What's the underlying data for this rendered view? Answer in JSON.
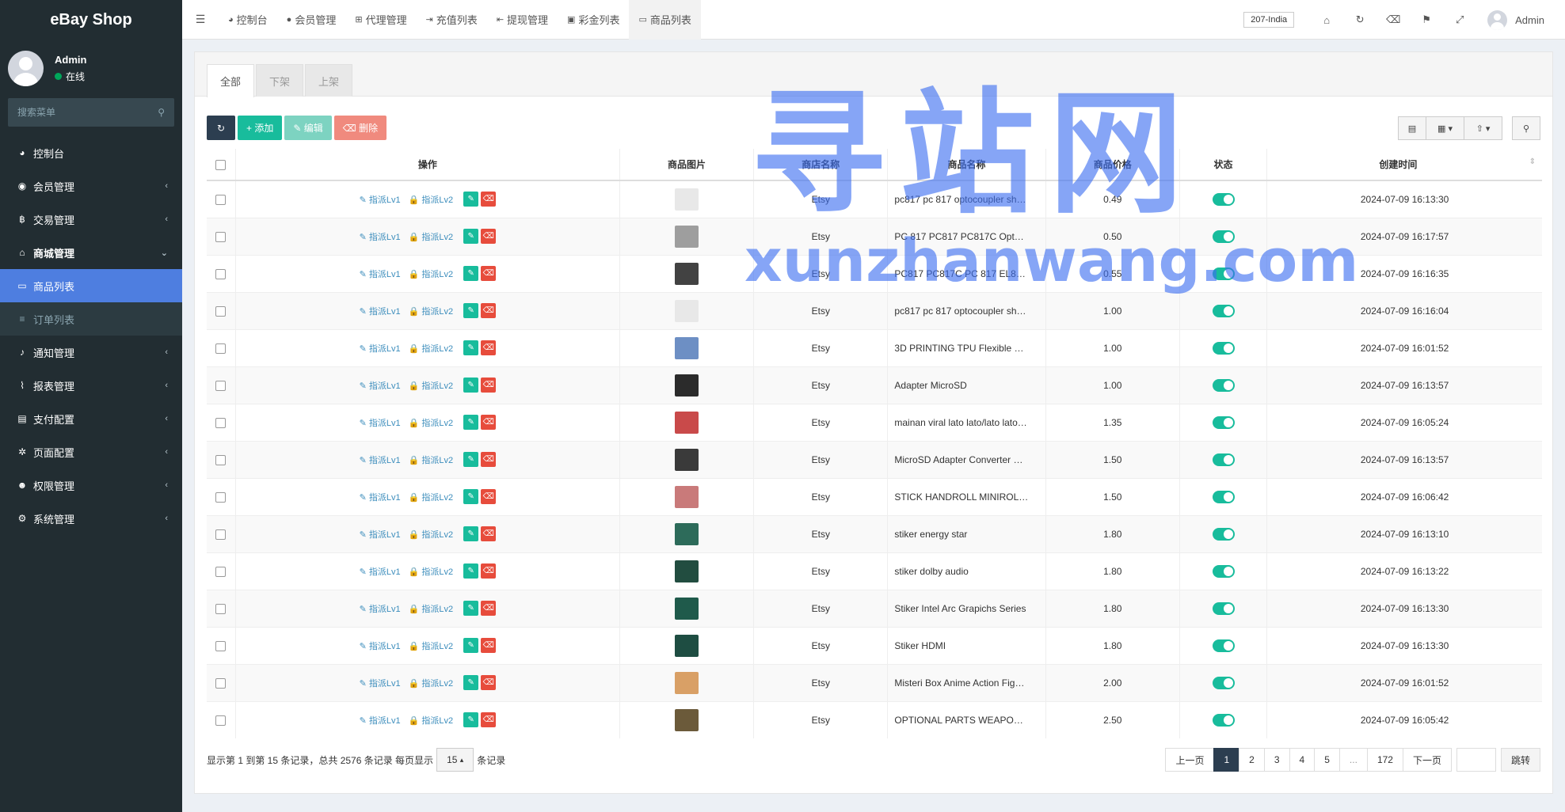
{
  "brand": {
    "title": "eBay Shop"
  },
  "user": {
    "name": "Admin",
    "status": "在线"
  },
  "search": {
    "placeholder": "搜索菜单"
  },
  "menu": [
    {
      "icon": "dashboard-icon",
      "glyph": "◕",
      "label": "控制台",
      "arrow": ""
    },
    {
      "icon": "user-circle-icon",
      "glyph": "◉",
      "label": "会员管理",
      "arrow": "‹"
    },
    {
      "icon": "bitcoin-icon",
      "glyph": "฿",
      "label": "交易管理",
      "arrow": "‹"
    },
    {
      "icon": "home-icon",
      "glyph": "⌂",
      "label": "商城管理",
      "arrow": "⌄"
    },
    {
      "icon": "desktop-icon",
      "glyph": "▭",
      "label": "商品列表",
      "arrow": ""
    },
    {
      "icon": "list-icon",
      "glyph": "≡",
      "label": "订单列表",
      "arrow": ""
    },
    {
      "icon": "bell-icon",
      "glyph": "♪",
      "label": "通知管理",
      "arrow": "‹"
    },
    {
      "icon": "chart-line-icon",
      "glyph": "⌇",
      "label": "报表管理",
      "arrow": "‹"
    },
    {
      "icon": "credit-card-icon",
      "glyph": "▤",
      "label": "支付配置",
      "arrow": "‹"
    },
    {
      "icon": "gear-icon",
      "glyph": "✲",
      "label": "页面配置",
      "arrow": "‹"
    },
    {
      "icon": "users-icon",
      "glyph": "☻",
      "label": "权限管理",
      "arrow": "‹"
    },
    {
      "icon": "cogs-icon",
      "glyph": "⚙",
      "label": "系统管理",
      "arrow": "‹"
    }
  ],
  "nav_tabs": [
    {
      "icon": "dashboard-icon",
      "glyph": "◕",
      "label": "控制台"
    },
    {
      "icon": "user-icon",
      "glyph": "●",
      "label": "会员管理"
    },
    {
      "icon": "sitemap-icon",
      "glyph": "⊞",
      "label": "代理管理"
    },
    {
      "icon": "sign-in-icon",
      "glyph": "⇥",
      "label": "充值列表"
    },
    {
      "icon": "sign-out-icon",
      "glyph": "⇤",
      "label": "提现管理"
    },
    {
      "icon": "gift-icon",
      "glyph": "▣",
      "label": "彩金列表"
    },
    {
      "icon": "desktop-icon",
      "glyph": "▭",
      "label": "商品列表"
    }
  ],
  "header": {
    "region": "207-India",
    "admin": "Admin"
  },
  "panel_tabs": [
    "全部",
    "下架",
    "上架"
  ],
  "toolbar": {
    "add": "添加",
    "edit": "编辑",
    "delete": "删除"
  },
  "table": {
    "headers": [
      "操作",
      "商品图片",
      "商店名称",
      "商品名称",
      "商品价格",
      "状态",
      "创建时间"
    ],
    "op_lv1": "指派Lv1",
    "op_lv2": "指派Lv2",
    "rows": [
      {
        "shop": "Etsy",
        "name": "pc817 pc 817 optocoupler sh…",
        "price": "0.49",
        "time": "2024-07-09 16:13:30",
        "thumb": "#e8e8e8"
      },
      {
        "shop": "Etsy",
        "name": "PC 817 PC817 PC817C Opt…",
        "price": "0.50",
        "time": "2024-07-09 16:17:57",
        "thumb": "#9e9e9e"
      },
      {
        "shop": "Etsy",
        "name": "PC817 PC817C PC 817 EL8…",
        "price": "0.55",
        "time": "2024-07-09 16:16:35",
        "thumb": "#424242"
      },
      {
        "shop": "Etsy",
        "name": "pc817 pc 817 optocoupler sh…",
        "price": "1.00",
        "time": "2024-07-09 16:16:04",
        "thumb": "#e8e8e8"
      },
      {
        "shop": "Etsy",
        "name": "3D PRINTING TPU Flexible …",
        "price": "1.00",
        "time": "2024-07-09 16:01:52",
        "thumb": "#6d8fc4"
      },
      {
        "shop": "Etsy",
        "name": "Adapter MicroSD",
        "price": "1.00",
        "time": "2024-07-09 16:13:57",
        "thumb": "#2b2b2b"
      },
      {
        "shop": "Etsy",
        "name": "mainan viral lato lato/lato lato…",
        "price": "1.35",
        "time": "2024-07-09 16:05:24",
        "thumb": "#c94a4a"
      },
      {
        "shop": "Etsy",
        "name": "MicroSD Adapter Converter …",
        "price": "1.50",
        "time": "2024-07-09 16:13:57",
        "thumb": "#3a3a3a"
      },
      {
        "shop": "Etsy",
        "name": "STICK HANDROLL MINIROL…",
        "price": "1.50",
        "time": "2024-07-09 16:06:42",
        "thumb": "#c97a7a"
      },
      {
        "shop": "Etsy",
        "name": "stiker energy star",
        "price": "1.80",
        "time": "2024-07-09 16:13:10",
        "thumb": "#2d6b5a"
      },
      {
        "shop": "Etsy",
        "name": "stiker dolby audio",
        "price": "1.80",
        "time": "2024-07-09 16:13:22",
        "thumb": "#224d40"
      },
      {
        "shop": "Etsy",
        "name": "Stiker Intel Arc Grapichs Series",
        "price": "1.80",
        "time": "2024-07-09 16:13:30",
        "thumb": "#1f5a4b"
      },
      {
        "shop": "Etsy",
        "name": "Stiker HDMI",
        "price": "1.80",
        "time": "2024-07-09 16:13:30",
        "thumb": "#1e4d42"
      },
      {
        "shop": "Etsy",
        "name": "Misteri Box Anime Action Fig…",
        "price": "2.00",
        "time": "2024-07-09 16:01:52",
        "thumb": "#d9a066"
      },
      {
        "shop": "Etsy",
        "name": "OPTIONAL PARTS WEAPO…",
        "price": "2.50",
        "time": "2024-07-09 16:05:42",
        "thumb": "#6b5a3a"
      }
    ]
  },
  "footer": {
    "info_prefix": "显示第 1 到第 15 条记录，总共 2576 条记录 每页显示",
    "page_size": "15",
    "info_suffix": "条记录",
    "prev": "上一页",
    "next": "下一页",
    "pages": [
      "1",
      "2",
      "3",
      "4",
      "5",
      "...",
      "172"
    ],
    "goto": "跳转"
  },
  "watermark": {
    "cn": "寻站网",
    "en": "xunzhanwang.com"
  },
  "colors": {
    "sidebar": "#222d32",
    "active": "#4e7ee0",
    "primary": "#18bc9c",
    "danger": "#e74c3c",
    "dark": "#2c3e50"
  }
}
